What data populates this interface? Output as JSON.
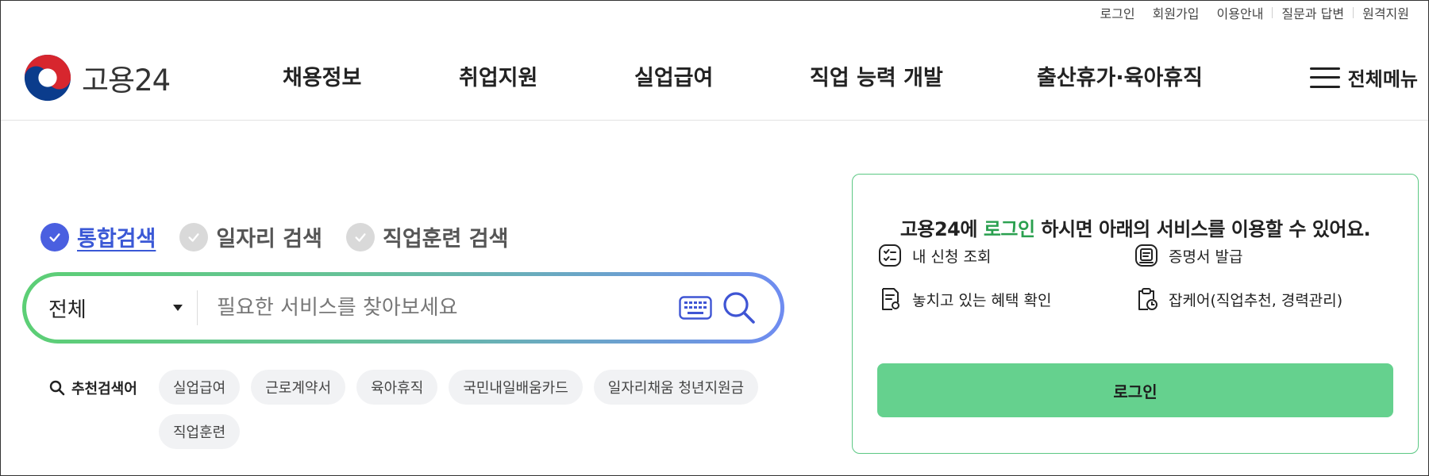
{
  "utility_nav": [
    "로그인",
    "회원가입",
    "이용안내",
    "질문과 답변",
    "원격지원"
  ],
  "brand": {
    "name": "고용24"
  },
  "gnb": [
    "채용정보",
    "취업지원",
    "실업급여",
    "직업 능력 개발",
    "출산휴가·육아휴직"
  ],
  "all_menu_label": "전체메뉴",
  "search": {
    "tabs": [
      {
        "label": "통합검색",
        "active": true
      },
      {
        "label": "일자리 검색",
        "active": false
      },
      {
        "label": "직업훈련 검색",
        "active": false
      }
    ],
    "category_value": "전체",
    "placeholder": "필요한 서비스를 찾아보세요",
    "recommended_title": "추천검색어",
    "keywords": [
      "실업급여",
      "근로계약서",
      "육아휴직",
      "국민내일배움카드",
      "일자리채움 청년지원금",
      "직업훈련"
    ]
  },
  "login_panel": {
    "title_pre": "고용24에 ",
    "title_highlight": "로그인",
    "title_post": " 하시면 아래의 서비스를 이용할 수 있어요.",
    "services": [
      "내 신청 조회",
      "증명서 발급",
      "놓치고 있는 혜택 확인",
      "잡케어(직업추천, 경력관리)"
    ],
    "button_label": "로그인"
  },
  "colors": {
    "primary_blue": "#4a5fe0",
    "green": "#2aa04f",
    "login_button": "#65d18e"
  }
}
